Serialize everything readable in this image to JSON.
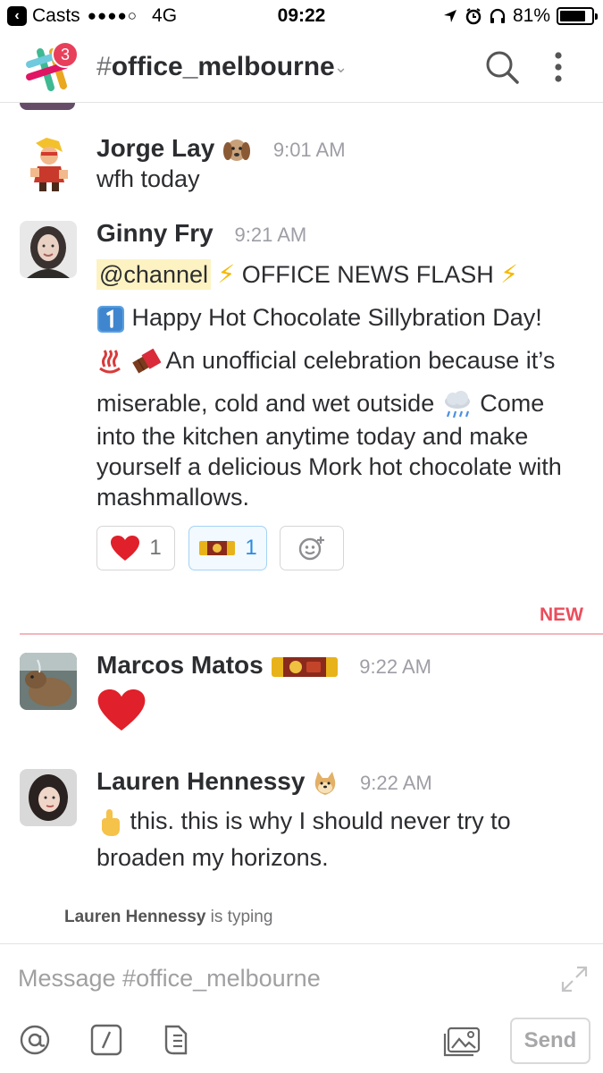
{
  "status_bar": {
    "back_app": "Casts",
    "signal_dots": "●●●●○",
    "network": "4G",
    "time": "09:22",
    "battery_percent": "81%",
    "battery_level": 0.81
  },
  "header": {
    "notification_count": "3",
    "channel_hash": "#",
    "channel_name": "office_melbourne",
    "chevron": "⌄"
  },
  "messages": [
    {
      "author": "Jorge Lay",
      "time": "9:01 AM",
      "text": "wfh today",
      "status_emoji": "dog-emoji"
    },
    {
      "author": "Ginny Fry",
      "time": "9:21 AM",
      "mention": "@channel",
      "headline": "OFFICE NEWS FLASH",
      "line2": "Happy Hot Chocolate Sillybration Day!",
      "line3": "An unofficial celebration because it’s",
      "line4": "miserable, cold and wet outside",
      "line4b": "Come",
      "line5": "into the kitchen anytime today and make yourself a delicious Mork hot chocolate with mashmallows.",
      "reactions": [
        {
          "emoji": "heart-emoji",
          "count": "1",
          "active": false
        },
        {
          "emoji": "mork-chocolate-emoji",
          "count": "1",
          "active": true
        }
      ]
    },
    {
      "author": "Marcos Matos",
      "time": "9:22 AM",
      "status_emoji": "mork-chocolate-emoji",
      "body_emoji": "heart-emoji"
    },
    {
      "author": "Lauren Hennessy",
      "time": "9:22 AM",
      "status_emoji": "doge-emoji",
      "text": "this. this is why I should never try to broaden my horizons."
    }
  ],
  "divider": {
    "label": "NEW"
  },
  "typing": {
    "user": "Lauren Hennessy",
    "suffix": " is typing"
  },
  "composer": {
    "placeholder": "Message #office_melbourne",
    "send_label": "Send"
  },
  "colors": {
    "mention_bg": "#fdf3c2",
    "new_divider": "#eb4d5c",
    "badge": "#e8405a",
    "active_reaction": "#2b8be0"
  }
}
